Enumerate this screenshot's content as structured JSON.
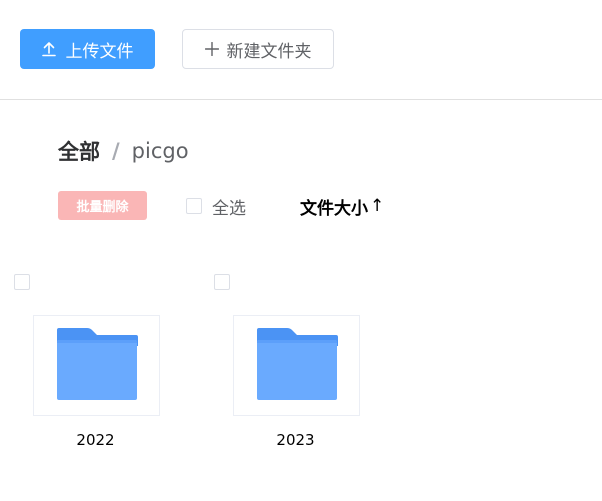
{
  "toolbar": {
    "upload_label": "上传文件",
    "new_folder_label": "新建文件夹"
  },
  "breadcrumb": {
    "root": "全部",
    "separator": "/",
    "current": "picgo"
  },
  "actions": {
    "batch_delete_label": "批量删除",
    "select_all_label": "全选",
    "sort_label": "文件大小",
    "sort_arrow": "↑"
  },
  "folders": [
    {
      "name": "2022"
    },
    {
      "name": "2023"
    }
  ],
  "colors": {
    "primary": "#409eff",
    "danger_light": "#fab6b6",
    "folder_body": "#6aaafe",
    "folder_back": "#4b93f4"
  },
  "icons": {
    "upload": "upload-icon",
    "plus": "plus-icon",
    "folder": "folder-icon"
  }
}
